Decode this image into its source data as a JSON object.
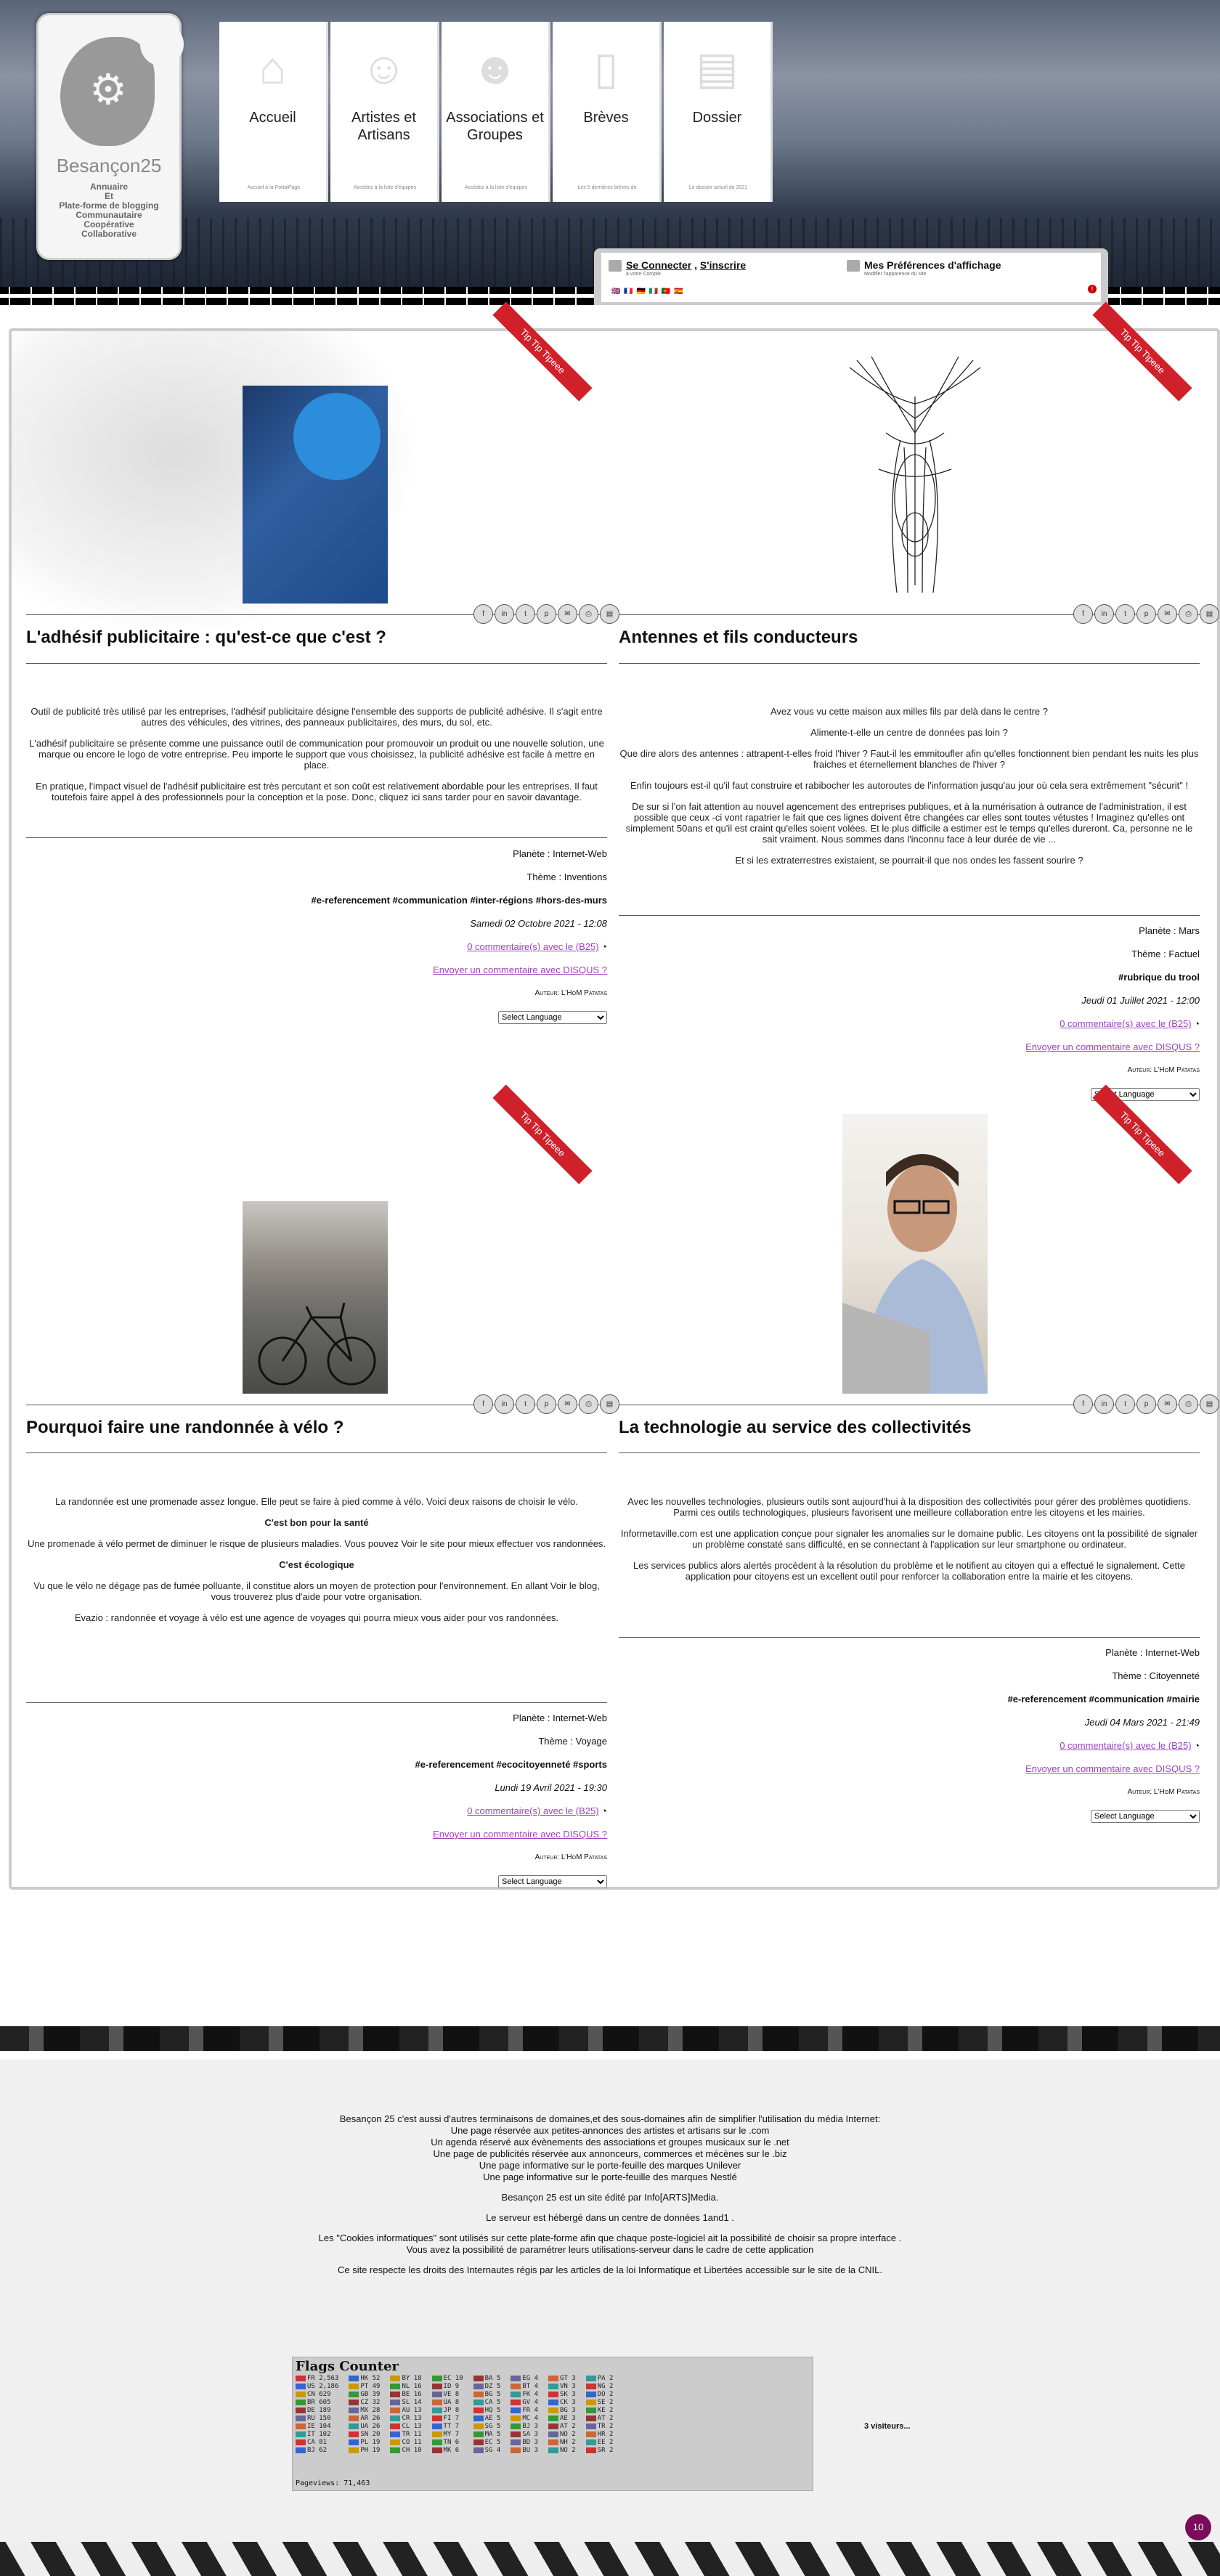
{
  "site": {
    "logo_name": "Besançon25",
    "logo_tagline": [
      "Annuaire",
      "Et",
      "Plate-forme de blogging",
      "Communautaire",
      "Coopérative",
      "Collaborative"
    ]
  },
  "nav": [
    {
      "label": "Accueil",
      "sub": "Accueil à la PortalPage",
      "icon": "home-icon"
    },
    {
      "label": "Artistes et Artisans",
      "sub": "Accédez à la liste d'équipes",
      "icon": "user-icon"
    },
    {
      "label": "Associations et Groupes",
      "sub": "Accédez à la liste d'équipes",
      "icon": "group-icon"
    },
    {
      "label": "Brèves",
      "sub": "Les 5 dernières brèves de",
      "icon": "document-icon"
    },
    {
      "label": "Dossier",
      "sub": "Le dossier actuel de 2021",
      "icon": "newspaper-icon"
    }
  ],
  "prefbar": {
    "connect": "Se Connecter",
    "register": "S'inscrire",
    "account_sub": "à votre Compte",
    "prefs": "Mes Préférences d'affichage",
    "prefs_sub": "Modifier l'apparence du site",
    "flags": "🇬🇧 🇫🇷 🇩🇪 🇮🇹 🇵🇹 🇪🇸"
  },
  "articles": [
    {
      "ribbon": "Tip Tip Tipeee",
      "title": "L'adhésif publicitaire : qu'est-ce que c'est ?",
      "paragraphs": [
        "Outil de publicité très utilisé par les entreprises, l'adhésif publicitaire désigne l'ensemble des supports de publicité adhésive. Il s'agit entre autres des véhicules, des vitrines, des panneaux publicitaires, des murs, du sol, etc.",
        "L'adhésif publicitaire se présente comme une puissance outil de communication pour promouvoir un produit ou une nouvelle solution, une marque ou encore le logo de votre entreprise. Peu importe le support que vous choisissez, la publicité adhésive est facile à mettre en place.",
        "En pratique, l'impact visuel de l'adhésif publicitaire est très percutant et son coût est relativement abordable pour les entreprises. Il faut toutefois faire appel à des professionnels pour la conception et la pose. Donc, cliquez ici sans tarder pour en savoir davantage."
      ],
      "planete": "Planète : Internet-Web",
      "theme": "Thème : Inventions",
      "tags": "#e-referencement #communication #inter-régions #hors-des-murs",
      "date": "Samedi 02 Octobre 2021 - 12:08",
      "comments": "0 commentaire(s) avec le (B25)",
      "disqus": "Envoyer un commentaire avec DISQUS ?",
      "author": "Auteur: L'HoM Patatas",
      "lang": "Select Language"
    },
    {
      "ribbon": "Tip Tip Tipeee",
      "title": "Antennes et fils conducteurs",
      "paragraphs": [
        "Avez vous vu cette maison aux milles fils par delà dans le centre ?",
        "Alimente-t-elle un centre de données pas loin ?",
        "Que dire alors des antennes : attrapent-t-elles froid l'hiver ? Faut-il les emmitoufler afin qu'elles fonctionnent bien pendant les nuits les plus fraiches et éternellement blanches de l'hiver ?",
        "Enfin toujours est-il qu'il faut construire et rabibocher les autoroutes de l'information jusqu'au jour où cela sera extrêmement \"sécurit\" !",
        "De sur si l'on fait attention au nouvel agencement des entreprises publiques, et à la numérisation à outrance de l'administration, il est possible que ceux -ci vont rapatrier le fait que ces lignes doivent être changées car elles sont toutes vétustes ! Imaginez qu'elles ont simplement 50ans et qu'il est craint qu'elles soient volées. Et le plus difficile a estimer est le temps qu'elles dureront. Ca, personne ne le sait vraiment. Nous sommes dans l'inconnu face à leur durée de vie ...",
        "Et si les extraterrestres existaient, se pourrait-il que nos ondes les fassent sourire ?"
      ],
      "planete": "Planète : Mars",
      "theme": "Thème : Factuel",
      "tags": "#rubrique du trool",
      "date": "Jeudi 01 Juillet 2021 - 12:00",
      "comments": "0 commentaire(s) avec le (B25)",
      "disqus": "Envoyer un commentaire avec DISQUS ?",
      "author": "Auteur: L'HoM Patatas",
      "lang": "Select Language"
    },
    {
      "ribbon": "Tip Tip Tipeee",
      "title": "Pourquoi faire une randonnée à vélo ?",
      "paragraphs": [
        "La randonnée est une promenade assez longue. Elle peut se faire à pied comme à vélo. Voici deux raisons de choisir le vélo.",
        "C'est bon pour la santé",
        "Une promenade à vélo permet de diminuer le risque de plusieurs maladies. Vous pouvez Voir le site pour mieux effectuer vos randonnées.",
        "C'est écologique",
        "Vu que le vélo ne dégage pas de fumée polluante, il constitue alors un moyen de protection pour l'environnement. En allant Voir le blog, vous trouverez plus d'aide pour votre organisation.",
        "Evazio : randonnée et voyage à vélo est une agence de voyages qui pourra mieux vous aider pour vos randonnées."
      ],
      "planete": "Planète : Internet-Web",
      "theme": "Thème : Voyage",
      "tags": "#e-referencement #ecocitoyenneté #sports",
      "date": "Lundi 19 Avril 2021 - 19:30",
      "comments": "0 commentaire(s) avec le (B25)",
      "disqus": "Envoyer un commentaire avec DISQUS ?",
      "author": "Auteur: L'HoM Patatas",
      "lang": "Select Language"
    },
    {
      "ribbon": "Tip Tip Tipeee",
      "title": "La technologie au service des collectivités",
      "paragraphs": [
        "Avec les nouvelles technologies, plusieurs outils sont aujourd'hui à la disposition des collectivités pour gérer des problèmes quotidiens. Parmi ces outils technologiques, plusieurs favorisent une meilleure collaboration entre les citoyens et les mairies.",
        "Informetaville.com est une application conçue pour signaler les anomalies sur le domaine public. Les citoyens ont la possibilité de signaler un problème constaté sans difficulté, en se connectant à l'application sur leur smartphone ou ordinateur.",
        "Les services publics alors alertés procèdent à la résolution du problème et le notifient au citoyen qui a effectué le signalement. Cette application pour citoyens est un excellent outil pour renforcer la collaboration entre la mairie et les citoyens."
      ],
      "planete": "Planète : Internet-Web",
      "theme": "Thème : Citoyenneté",
      "tags": "#e-referencement #communication #mairie",
      "date": "Jeudi 04 Mars 2021 - 21:49",
      "comments": "0 commentaire(s) avec le (B25)",
      "disqus": "Envoyer un commentaire avec DISQUS ?",
      "author": "Auteur: L'HoM Patatas",
      "lang": "Select Language"
    }
  ],
  "share_icons": [
    "f",
    "in",
    "🐦",
    "◎",
    "✉",
    "🖶",
    "⎙"
  ],
  "footer": {
    "lines": [
      "Besançon 25 c'est aussi d'autres terminaisons de domaines,et des sous-domaines afin de simplifier l'utilisation du média Internet:",
      "Une page réservée aux petites-annonces des artistes et artisans sur le .com",
      "Un agenda réservé aux évènements des associations et groupes musicaux sur le .net",
      "Une page de publicités réservée aux annonceurs, commerces et mécènes sur le .biz",
      "Une page informative sur le porte-feuille des marques Unilever",
      "Une page informative sur le porte-feuille des marques Nestlé"
    ],
    "editor": "Besançon 25 est un site édité par Info[ARTS]Media.",
    "server": "Le serveur est hébergé dans un centre de données 1and1 .",
    "cookies1": "Les \"Cookies informatiques\" sont utilisés sur cette plate-forme afin que chaque poste-logiciel ait la possibilité de choisir sa propre interface .",
    "cookies2": "Vous avez la possibilité de paramétrer leurs utilisations-serveur dans le cadre de cette application",
    "cnil": "Ce site respecte les droits des Internautes régis par les articles de la loi Informatique et Libertées accessible sur le site de la CNIL.",
    "flags_title": "Flags Counter",
    "pageviews": "Pageviews: 71,463",
    "visitors": "3 visiteurs...",
    "badge": "10",
    "flag_columns": [
      [
        "FR 2,563",
        "US 2,186",
        "CN 629",
        "BR 605",
        "DE 189",
        "RU 150",
        "IE 104",
        "IT 102",
        "CA 81",
        "BJ 62"
      ],
      [
        "HK 52",
        "PT 49",
        "GB 39",
        "CZ 32",
        "MX 28",
        "AR 26",
        "UA 26",
        "SN 20",
        "PL 19",
        "PH 19"
      ],
      [
        "BY 18",
        "NL 16",
        "BE 16",
        "SL 14",
        "AU 13",
        "CR 13",
        "CL 13",
        "TR 11",
        "CO 11",
        "CH 10"
      ],
      [
        "EC 10",
        "ID 9",
        "VE 8",
        "UA 8",
        "JP 8",
        "FI 7",
        "TT 7",
        "MY 7",
        "TN 6",
        "MK 6"
      ],
      [
        "BA 5",
        "DZ 5",
        "BG 5",
        "CA 5",
        "HQ 5",
        "AE 5",
        "SG 5",
        "MA 5",
        "EC 5",
        "SG 4"
      ],
      [
        "EG 4",
        "BT 4",
        "FK 4",
        "GV 4",
        "FR 4",
        "MC 4",
        "BJ 3",
        "SA 3",
        "BD 3",
        "BU 3"
      ],
      [
        "GT 3",
        "VN 3",
        "SK 3",
        "CK 3",
        "BG 3",
        "AE 3",
        "AT 2",
        "NO 2",
        "NH 2",
        "NO 2"
      ],
      [
        "PA 2",
        "NG 2",
        "DO 2",
        "SE 2",
        "KE 2",
        "AT 2",
        "TR 2",
        "HR 2",
        "EE 2",
        "SR 2"
      ]
    ]
  }
}
